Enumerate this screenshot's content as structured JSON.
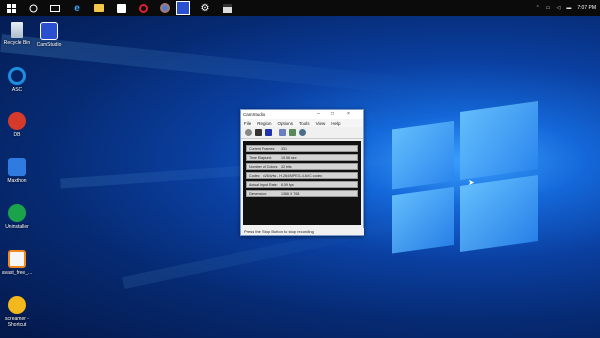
{
  "taskbar": {
    "icons": [
      "start-icon",
      "search-icon",
      "task-view-icon",
      "edge-icon",
      "file-explorer-icon",
      "store-icon",
      "opera-icon",
      "firefox-icon",
      "camstudio-icon",
      "settings-icon",
      "clapper-icon"
    ],
    "time": "7:07 PM",
    "date": ""
  },
  "desktop_icons": [
    {
      "label": "Recycle Bin",
      "icon": "recycle-bin-icon",
      "color": "#cfd8e3"
    },
    {
      "label": "CamStudio",
      "icon": "camstudio-icon",
      "color": "#2a5bd8"
    },
    {
      "label": "ASC",
      "icon": "asc-icon",
      "color": "#1d8fe0"
    },
    {
      "label": "DB",
      "icon": "db-icon",
      "color": "#d63a2a"
    },
    {
      "label": "Maxthon",
      "icon": "maxthon-icon",
      "color": "#2f7be0"
    },
    {
      "label": "Uninstaller",
      "icon": "uninstaller-icon",
      "color": "#1aa34a"
    },
    {
      "label": "avast_free_...",
      "icon": "avast-icon",
      "color": "#f08a1c"
    },
    {
      "label": "screamer - Shortcut",
      "icon": "screamer-icon",
      "color": "#f2b81c"
    }
  ],
  "window": {
    "title": "CamStudio",
    "menu": [
      "File",
      "Region",
      "Options",
      "Tools",
      "View",
      "Help"
    ],
    "fields": [
      {
        "key": "Current Frames:",
        "value": "331"
      },
      {
        "key": "Time Elapsed:",
        "value": "19.56 sec"
      },
      {
        "key": "Number of Colors:",
        "value": "32 bits"
      },
      {
        "key": "Codec:",
        "value": "x264vfw - H.264/MPEG-4 AVC codec"
      },
      {
        "key": "Actual Input Rate:",
        "value": "8.59 fps"
      },
      {
        "key": "Dimension:",
        "value": "1366 X 768"
      }
    ],
    "status": "Press the Stop Button to stop recording"
  }
}
